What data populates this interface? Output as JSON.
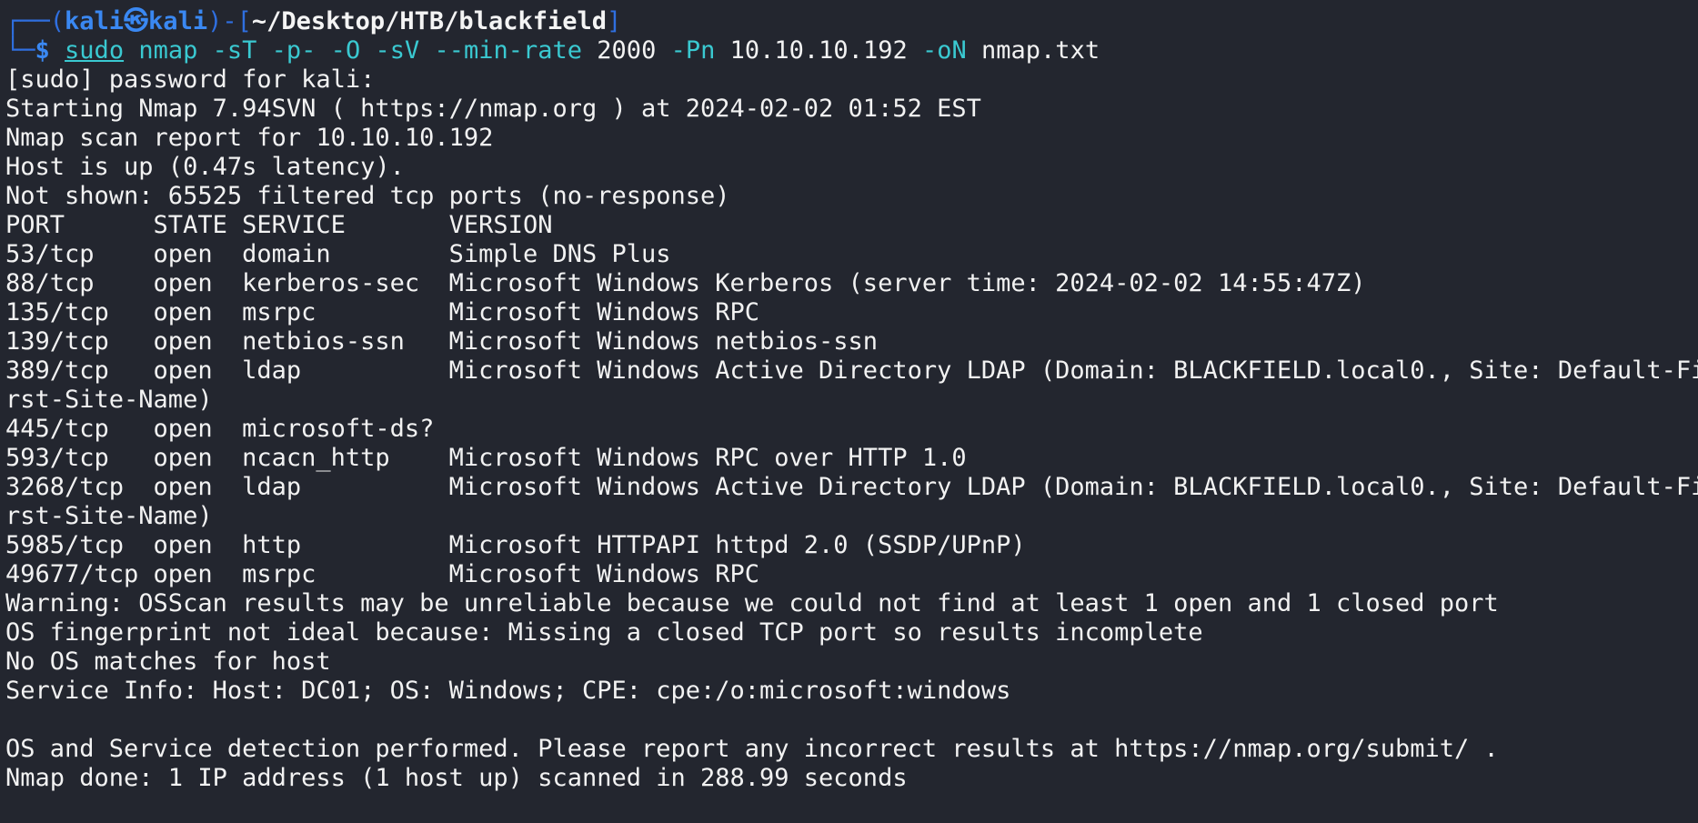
{
  "prompt": {
    "frame_top": "┌──(",
    "user": "kali㉿kali",
    "frame_mid": ")-[",
    "path": "~/Desktop/HTB/blackfield",
    "frame_end": "]",
    "frame_bottom": "└─",
    "symbol": "$"
  },
  "command": {
    "sudo": "sudo",
    "program": "nmap",
    "flags1": "-sT -p- -O -sV --min-rate",
    "rate": "2000",
    "flag_pn": "-Pn",
    "target": "10.10.10.192",
    "flag_on": "-oN",
    "outfile": "nmap.txt"
  },
  "output_lines": [
    "[sudo] password for kali:",
    "Starting Nmap 7.94SVN ( https://nmap.org ) at 2024-02-02 01:52 EST",
    "Nmap scan report for 10.10.10.192",
    "Host is up (0.47s latency).",
    "Not shown: 65525 filtered tcp ports (no-response)",
    "PORT      STATE SERVICE       VERSION",
    "53/tcp    open  domain        Simple DNS Plus",
    "88/tcp    open  kerberos-sec  Microsoft Windows Kerberos (server time: 2024-02-02 14:55:47Z)",
    "135/tcp   open  msrpc         Microsoft Windows RPC",
    "139/tcp   open  netbios-ssn   Microsoft Windows netbios-ssn",
    "389/tcp   open  ldap          Microsoft Windows Active Directory LDAP (Domain: BLACKFIELD.local0., Site: Default-Fi",
    "rst-Site-Name)",
    "445/tcp   open  microsoft-ds?",
    "593/tcp   open  ncacn_http    Microsoft Windows RPC over HTTP 1.0",
    "3268/tcp  open  ldap          Microsoft Windows Active Directory LDAP (Domain: BLACKFIELD.local0., Site: Default-Fi",
    "rst-Site-Name)",
    "5985/tcp  open  http          Microsoft HTTPAPI httpd 2.0 (SSDP/UPnP)",
    "49677/tcp open  msrpc         Microsoft Windows RPC",
    "Warning: OSScan results may be unreliable because we could not find at least 1 open and 1 closed port",
    "OS fingerprint not ideal because: Missing a closed TCP port so results incomplete",
    "No OS matches for host",
    "Service Info: Host: DC01; OS: Windows; CPE: cpe:/o:microsoft:windows",
    "",
    "OS and Service detection performed. Please report any incorrect results at https://nmap.org/submit/ .",
    "Nmap done: 1 IP address (1 host up) scanned in 288.99 seconds"
  ],
  "colors": {
    "background": "#23262f",
    "prompt_frame": "#2f6fe0",
    "prompt_user": "#3a88f2",
    "command_keyword": "#3ac9d1",
    "text": "#f2f2f2"
  }
}
